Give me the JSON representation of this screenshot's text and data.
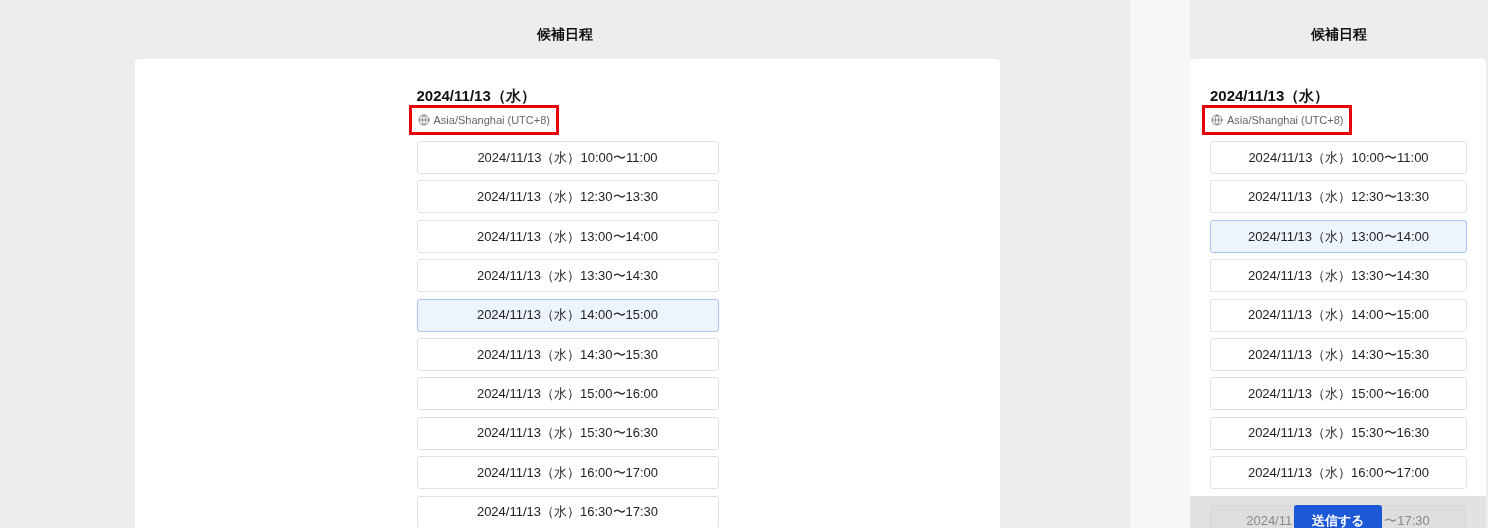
{
  "desktop": {
    "title": "候補日程",
    "date": "2024/11/13（水）",
    "timezone": {
      "label": "Asia/Shanghai (UTC+8)",
      "highlighted": true
    },
    "slots": [
      {
        "label": "2024/11/13（水）10:00〜11:00",
        "selected": false
      },
      {
        "label": "2024/11/13（水）12:30〜13:30",
        "selected": false
      },
      {
        "label": "2024/11/13（水）13:00〜14:00",
        "selected": false
      },
      {
        "label": "2024/11/13（水）13:30〜14:30",
        "selected": false
      },
      {
        "label": "2024/11/13（水）14:00〜15:00",
        "selected": true
      },
      {
        "label": "2024/11/13（水）14:30〜15:30",
        "selected": false
      },
      {
        "label": "2024/11/13（水）15:00〜16:00",
        "selected": false
      },
      {
        "label": "2024/11/13（水）15:30〜16:30",
        "selected": false
      },
      {
        "label": "2024/11/13（水）16:00〜17:00",
        "selected": false
      },
      {
        "label": "2024/11/13（水）16:30〜17:30",
        "selected": false
      }
    ]
  },
  "mobile": {
    "title": "候補日程",
    "date": "2024/11/13（水）",
    "timezone": {
      "label": "Asia/Shanghai (UTC+8)",
      "highlighted": true
    },
    "slots": [
      {
        "label": "2024/11/13（水）10:00〜11:00",
        "selected": false
      },
      {
        "label": "2024/11/13（水）12:30〜13:30",
        "selected": false
      },
      {
        "label": "2024/11/13（水）13:00〜14:00",
        "selected": true
      },
      {
        "label": "2024/11/13（水）13:30〜14:30",
        "selected": false
      },
      {
        "label": "2024/11/13（水）14:00〜15:00",
        "selected": false
      },
      {
        "label": "2024/11/13（水）14:30〜15:30",
        "selected": false
      },
      {
        "label": "2024/11/13（水）15:00〜16:00",
        "selected": false
      },
      {
        "label": "2024/11/13（水）15:30〜16:30",
        "selected": false
      },
      {
        "label": "2024/11/13（水）16:00〜17:00",
        "selected": false
      }
    ],
    "partial_slot": {
      "visible_start": "2024/11",
      "visible_end": "〜17:30"
    },
    "submit_button": "送信する"
  }
}
